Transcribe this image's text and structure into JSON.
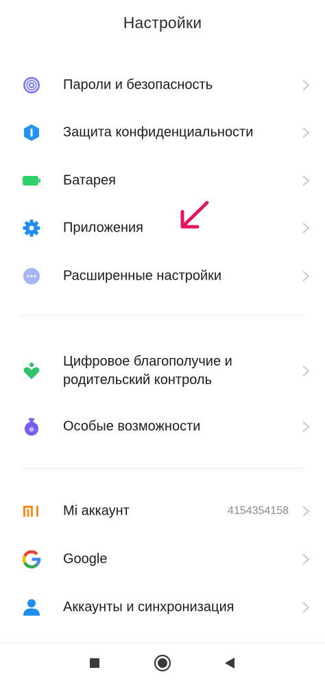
{
  "header": {
    "title": "Настройки"
  },
  "sections": [
    {
      "items": [
        {
          "label": "Пароли и безопасность",
          "icon": "fingerprint-icon",
          "color": "#6e6ef0"
        },
        {
          "label": "Защита конфиденциальности",
          "icon": "privacy-shield-icon",
          "color": "#1f94f0"
        },
        {
          "label": "Батарея",
          "icon": "battery-icon",
          "color": "#2fd16a"
        },
        {
          "label": "Приложения",
          "icon": "gear-icon",
          "color": "#1f8cf0"
        },
        {
          "label": "Расширенные настройки",
          "icon": "more-dots-icon",
          "color": "#9fb3f0"
        }
      ]
    },
    {
      "items": [
        {
          "label_line1": "Цифровое благополучие и",
          "label_line2": "родительский контроль",
          "icon": "wellbeing-heart-icon",
          "color": "#2fc26a"
        },
        {
          "label": "Особые возможности",
          "icon": "accessibility-flask-icon",
          "color": "#7a5cf0"
        }
      ]
    },
    {
      "items": [
        {
          "label": "Mi аккаунт",
          "value": "4154354158",
          "icon": "mi-logo-icon",
          "color": "#ff8a1c"
        },
        {
          "label": "Google",
          "icon": "google-g-icon",
          "color": "#4285f4"
        },
        {
          "label": "Аккаунты и синхронизация",
          "icon": "user-account-icon",
          "color": "#1f8cf0"
        }
      ]
    }
  ],
  "annotation": {
    "icon": "pointer-arrow-icon",
    "color": "#e0185f"
  },
  "navbar": {
    "recents_icon": "square-recents-icon",
    "home_icon": "circle-home-icon",
    "back_icon": "triangle-back-icon"
  }
}
